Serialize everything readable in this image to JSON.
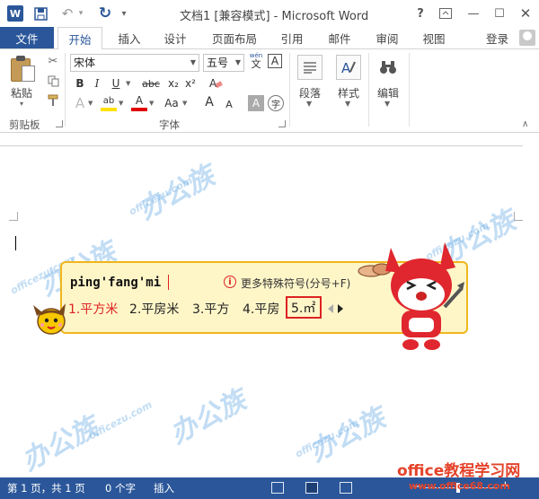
{
  "titlebar": {
    "app_icon": "W",
    "title": "文档1 [兼容模式] - Microsoft Word",
    "help": "?",
    "controls": {
      "minimize": "—",
      "maximize": "☐",
      "close": "✕"
    }
  },
  "tabs": {
    "file": "文件",
    "items": [
      "开始",
      "插入",
      "设计",
      "页面布局",
      "引用",
      "邮件",
      "审阅",
      "视图"
    ],
    "login": "登录"
  },
  "ribbon": {
    "clipboard": {
      "paste_label": "粘贴",
      "group_label": "剪贴板"
    },
    "font": {
      "font_name": "宋体",
      "font_size": "五号",
      "wen_label_top": "wén",
      "wen_label_bottom": "文",
      "char_border": "A",
      "bold": "B",
      "italic": "I",
      "underline": "U",
      "strikethrough": "abc",
      "subscript": "x₂",
      "superscript": "x²",
      "text_effects": "A",
      "highlight": "ab",
      "font_color": "A",
      "change_case": "Aa",
      "grow_font": "A",
      "shrink_font": "A",
      "char_shading": "A",
      "enclose_char": "字",
      "group_label": "字体"
    },
    "paragraph": {
      "label": "段落"
    },
    "styles": {
      "label": "样式"
    },
    "editing": {
      "label": "编辑"
    },
    "colors": {
      "accent": "#2b579a",
      "highlight": "#ffe000",
      "font_red": "#e00000"
    }
  },
  "ime": {
    "pinyin": "ping'fang'mi",
    "hint": "更多特殊符号(分号+F)",
    "candidates": [
      "1.平方米",
      "2.平房米",
      "3.平方",
      "4.平房",
      "5.㎡"
    ]
  },
  "watermark": {
    "brand": "办公族",
    "domain": "officezu.com"
  },
  "statusbar": {
    "page": "第 1 页，共 1 页",
    "words": "0 个字",
    "mode": "插入",
    "zoom_minus": "−",
    "zoom_plus": "+",
    "zoom_level": 0.46
  },
  "site": {
    "name": "office教程学习网",
    "url": "www.office68.com"
  }
}
